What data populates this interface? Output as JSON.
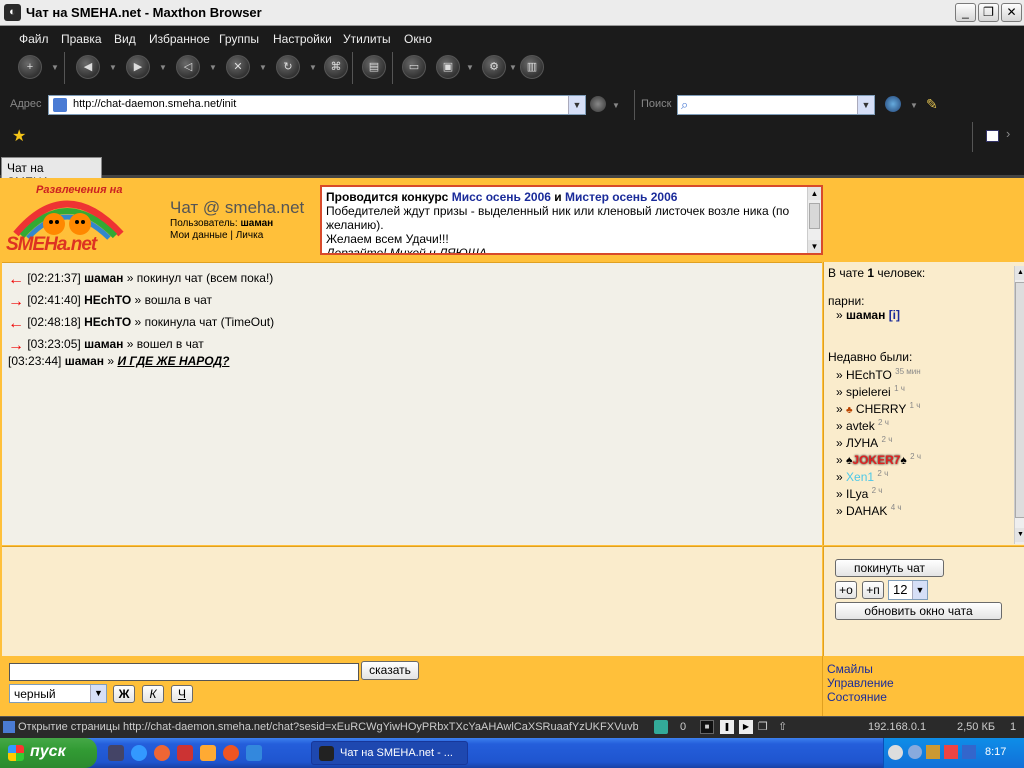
{
  "window": {
    "title": "Чат на SMEHA.net - Maxthon Browser",
    "min": "_",
    "max": "❐",
    "close": "✕"
  },
  "menu": [
    "Файл",
    "Правка",
    "Вид",
    "Избранное",
    "Группы",
    "Настройки",
    "Утилиты",
    "Окно"
  ],
  "address": {
    "label": "Адрес",
    "url": "http://chat-daemon.smeha.net/init"
  },
  "search": {
    "label": "Поиск",
    "value": ""
  },
  "tab": {
    "label": "Чат на SMEHA..."
  },
  "header": {
    "logo_top": "Развлечения на",
    "logo_brand": "SMEHa.net",
    "chat_title": "Чат @ smeha.net",
    "user_label": "Пользователь:",
    "username": "шаман",
    "my_data": "Мои данные",
    "separator": "|",
    "personal": "Личка"
  },
  "contest": {
    "line1_a": "Проводится конкурс",
    "line1_b": "Мисс осень 2006",
    "line1_c": "и",
    "line1_d": "Мистер осень 2006",
    "line2": "Победителей ждут призы - выделенный ник или кленовый листочек возле ника (по желанию).",
    "line3": "Желаем всем Удачи!!!",
    "line4": "Дерзайте! Михей и ЛЯЮША"
  },
  "messages": [
    {
      "dir": "←",
      "time": "[02:21:37]",
      "nick": "шаман",
      "sep": "»",
      "text": "покинул чат (всем пока!)"
    },
    {
      "dir": "→",
      "time": "[02:41:40]",
      "nick": "HEchTO",
      "sep": "»",
      "text": "вошла в чат"
    },
    {
      "dir": "←",
      "time": "[02:48:18]",
      "nick": "HEchTO",
      "sep": "»",
      "text": "покинула чат (TimeOut)"
    },
    {
      "dir": "→",
      "time": "[03:23:05]",
      "nick": "шаман",
      "sep": "»",
      "text": "вошел в чат"
    },
    {
      "dir": "",
      "time": "[03:23:44]",
      "nick": "шаман",
      "sep": "»",
      "text": "И ГДЕ ЖЕ НАРОД?"
    }
  ],
  "users": {
    "in_chat_a": "В чате",
    "in_chat_count": "1",
    "in_chat_b": "человек:",
    "guys_label": "парни:",
    "current": {
      "name": "шаман",
      "info": "[i]"
    },
    "recent_label": "Недавно были:",
    "recent": [
      {
        "name": "HEchTO",
        "ago": "35 мин"
      },
      {
        "name": "spielerei",
        "ago": "1 ч"
      },
      {
        "name": "CHERRY",
        "ago": "1 ч"
      },
      {
        "name": "avtek",
        "ago": "2 ч"
      },
      {
        "name": "ЛУНА",
        "ago": "2 ч"
      },
      {
        "name": "JOKER7",
        "ago": "2 ч"
      },
      {
        "name": "Xen1",
        "ago": "2 ч"
      },
      {
        "name": "ILya",
        "ago": "2 ч"
      },
      {
        "name": "DAHAK",
        "ago": "4 ч"
      }
    ]
  },
  "controls": {
    "leave": "покинуть чат",
    "plus_o": "+о",
    "plus_p": "+п",
    "font_size": "12",
    "refresh": "обновить окно чата"
  },
  "input": {
    "value": "",
    "say": "сказать",
    "color": "черный",
    "bold": "Ж",
    "italic": "К",
    "underline": "Ч"
  },
  "right_links": [
    "Смайлы",
    "Управление",
    "Состояние"
  ],
  "status": {
    "text": "Открытие страницы http://chat-daemon.smeha.net/chat?sesid=xEuRCWgYiwHOyPRbxTXcYaAHAwlCaXSRuaafYzUKFXVuvb",
    "count": "0",
    "ip": "192.168.0.1",
    "size": "2,50 КБ",
    "num": "1"
  },
  "taskbar": {
    "start": "пуск",
    "task": "Чат на SMEHA.net - ...",
    "clock": "8:17"
  }
}
